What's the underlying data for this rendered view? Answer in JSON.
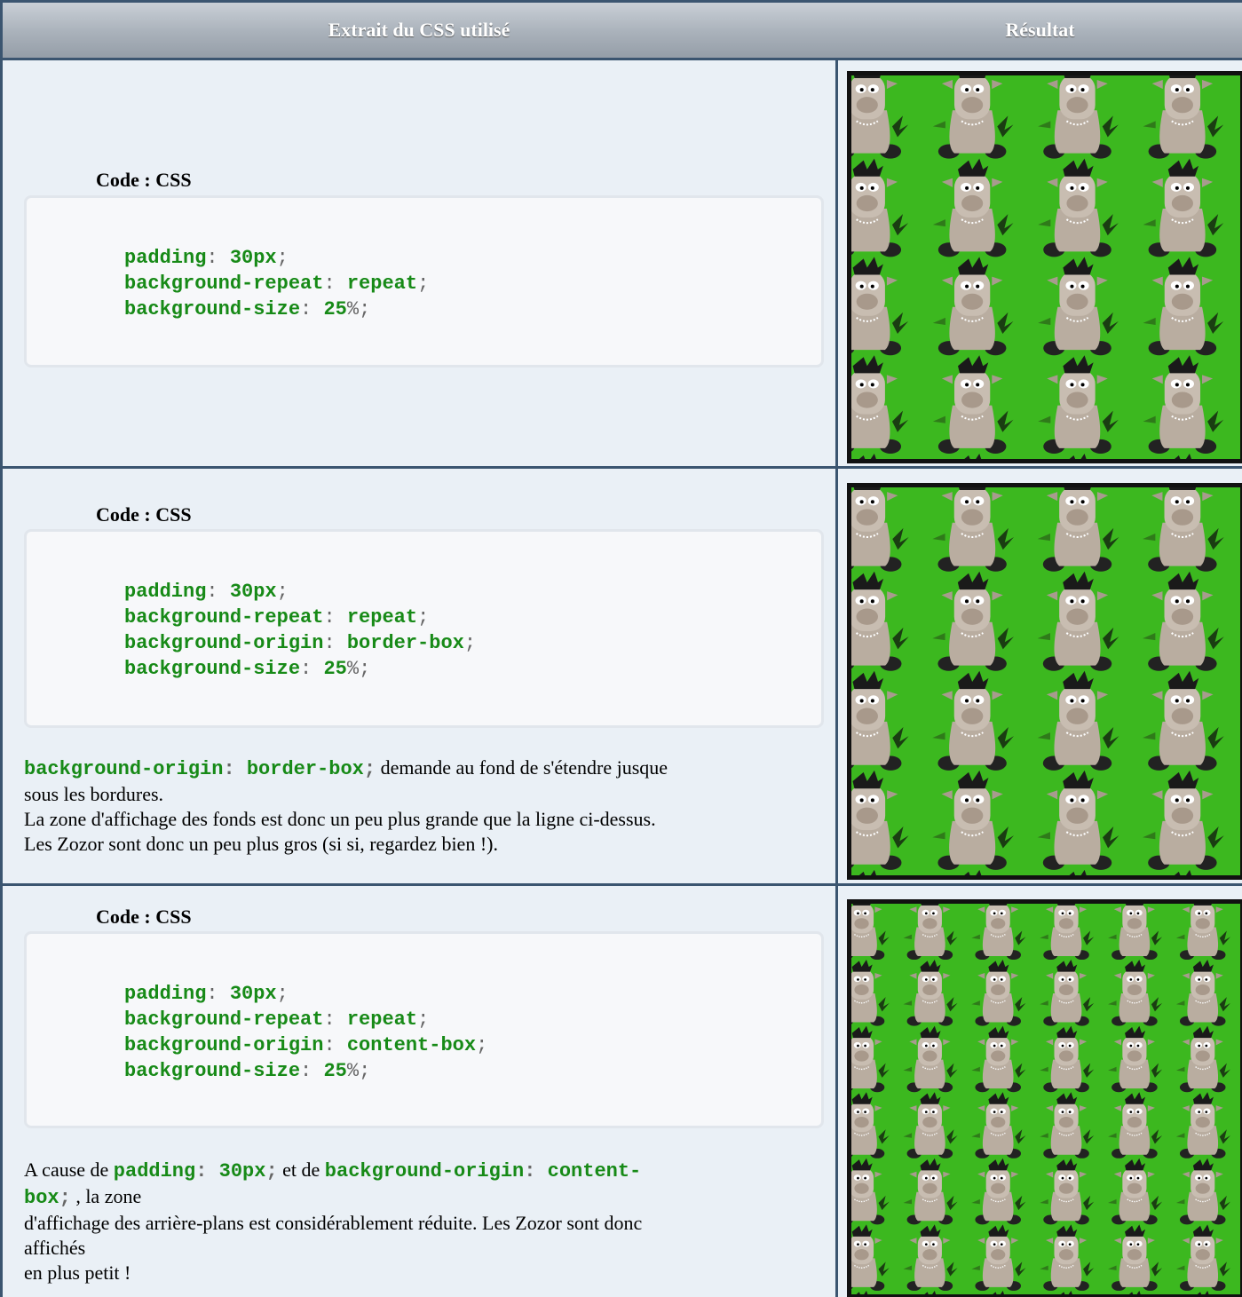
{
  "header": {
    "col_css": "Extrait du CSS utilisé",
    "col_result": "Résultat"
  },
  "rows": [
    {
      "code_title": "Code : CSS",
      "code": [
        {
          "prop": "padding",
          "value": "30px",
          "unit": ""
        },
        {
          "prop": "background-repeat",
          "value": "repeat",
          "unit": ""
        },
        {
          "prop": "background-size",
          "value": "25",
          "unit": "%"
        }
      ],
      "tiles": {
        "cols": 4,
        "rows": 4
      }
    },
    {
      "code_title": "Code : CSS",
      "code": [
        {
          "prop": "padding",
          "value": "30px",
          "unit": ""
        },
        {
          "prop": "background-repeat",
          "value": "repeat",
          "unit": ""
        },
        {
          "prop": "background-origin",
          "value": "border-box",
          "unit": ""
        },
        {
          "prop": "background-size",
          "value": "25",
          "unit": "%"
        }
      ],
      "desc": {
        "code_prop": "background-origin",
        "code_val": "border-box",
        "text1": " demande au fond de s'étendre jusque",
        "line2": "sous les bordures.",
        "line3": "La zone d'affichage des fonds est donc un peu plus grande que la ligne ci-dessus.",
        "line4": "Les Zozor sont donc un peu plus gros (si si, regardez bien !)."
      },
      "tiles": {
        "cols": 4,
        "rows": 4
      }
    },
    {
      "code_title": "Code : CSS",
      "code": [
        {
          "prop": "padding",
          "value": "30px",
          "unit": ""
        },
        {
          "prop": "background-repeat",
          "value": "repeat",
          "unit": ""
        },
        {
          "prop": "background-origin",
          "value": "content-box",
          "unit": ""
        },
        {
          "prop": "background-size",
          "value": "25",
          "unit": "%"
        }
      ],
      "desc": {
        "t1": "A cause de ",
        "c1_prop": "padding",
        "c1_val": "30px",
        "t2": " et de ",
        "c2_prop": "background-origin",
        "c2_val_a": "content-",
        "c2_val_b": "box",
        "t3": " , la zone",
        "line2": "d'affichage des arrière-plans est considérablement réduite. Les Zozor sont donc",
        "line3": "affichés",
        "line4": "en plus petit !"
      },
      "tiles": {
        "cols": 6,
        "rows": 6
      }
    }
  ],
  "colors": {
    "border": "#3b5570",
    "cell_bg": "#eaf0f6",
    "code_green": "#178a17",
    "grass": "#3cb81f"
  }
}
